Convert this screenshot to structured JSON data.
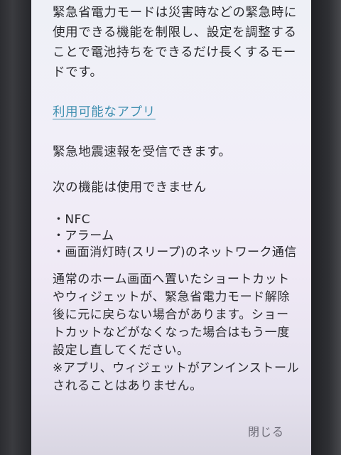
{
  "dialog": {
    "intro": "緊急省電力モードは災害時などの緊急時に使用できる機能を制限し、設定を調整することで電池持ちをできるだけ長くするモードです。",
    "available_apps_link": "利用可能なアプリ",
    "earthquake_text": "緊急地震速報を受信できます。",
    "unavailable_heading": "次の機能は使用できません",
    "unavailable_items": [
      "・NFC",
      "・アラーム",
      "・画面消灯時(スリープ)のネットワーク通信"
    ],
    "shortcut_notice": "通常のホーム画面へ置いたショートカットやウィジェットが、緊急省電力モード解除後に元に戻らない場合があります。ショートカットなどがなくなった場合はもう一度設定し直してください。",
    "uninstall_note": "※アプリ、ウィジェットがアンインストールされることはありません。",
    "close_label": "閉じる"
  },
  "colors": {
    "link": "#3f8fb0",
    "text": "#2a2a2e",
    "background": "#efeef6"
  }
}
